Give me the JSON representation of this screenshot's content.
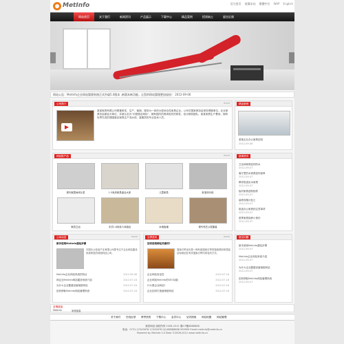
{
  "brand": {
    "logo_text": "MetInfo"
  },
  "toplinks": [
    "设为首页",
    "收藏本站",
    "繁體中文",
    "WAP",
    "English"
  ],
  "nav": [
    "网站首页",
    "关于我们",
    "新闻资讯",
    "产品展示",
    "下载中心",
    "精品案例",
    "招贤纳士",
    "留言反馈"
  ],
  "breadcrumb": "网站公告：MetInfo企业网站管理系统正式升级5.0版本 ,新版本新功能，让您的网站管理更加轻松！ 2012-09-06",
  "about": {
    "title": "公司简介",
    "more": "more",
    "body": "某某家具有限公司是集研发、生产、营销、服务为一体的大型综合性家具企业。公司中国家具协会常务理事单位，北京家具协会副会长单位，并被认定为\"中国驰名商标\"，拥有国内的具体相关的研发、设计精英团队。某某家具生产基地，拥有世界先进的德国豪迈家具生产流水线，高素质的专业技术人员。"
  },
  "cases": {
    "title": "精品案例",
    "more": "more",
    "caption": "某某企业办公家具定制",
    "date": "2012-09-08"
  },
  "products": {
    "title": "网站推产品",
    "more": "more",
    "items": [
      "现代家居休闲沙发",
      "1.5米床家具组合大床",
      "儿童家具",
      "卧室床头柜",
      "家具卫浴",
      "中式1.8米双人床组合",
      "木地板铺",
      "现代布艺沙发套装"
    ]
  },
  "news": {
    "title": "新闻资讯",
    "more": "more",
    "items": [
      {
        "t": "卫浴间家具如何防水",
        "d": "2012-09-07"
      },
      {
        "t": "客厅里的木家具如何保养",
        "d": "2012-09-07"
      },
      {
        "t": "教你挑选实木家具",
        "d": "2012-09-07"
      },
      {
        "t": "板材家具选购指导",
        "d": "2012-09-07"
      },
      {
        "t": "装修攻略小贴士",
        "d": "2012-09-07"
      },
      {
        "t": "挑选办公家具的注意事项",
        "d": "2012-09-07"
      },
      {
        "t": "夏季家具保养小常识",
        "d": "2012-09-07"
      }
    ]
  },
  "company": {
    "title": "公司动态",
    "more": "more",
    "headline": "新手使用MetInfo建站步骤",
    "body": "中国长沙信息产业有限公司是专注于企业网站建设系统研发的网络科技公司。",
    "items": [
      {
        "t": "MetInfo企业网站系统的特点",
        "d": "2012-09-06"
      },
      {
        "t": "网企业MetInfo网站建设系统介绍",
        "d": "2012-07-16"
      },
      {
        "t": "为什么企业要建设营销型网站",
        "d": "2012-07-16"
      },
      {
        "t": "如何获取MetInfo网站管理系统",
        "d": "2012-07-16"
      }
    ]
  },
  "industry": {
    "title": "业界资讯",
    "more": "more",
    "headline": "如何使用网站关键词?",
    "body": "搜索引擎优化是一种利用搜索引擎的搜索规则来提高目标网站在有关搜索引擎内排名的方式。",
    "items": [
      {
        "t": "企业网站安全性",
        "d": "2012-07-16"
      },
      {
        "t": "企业网站MetInfo的SEO功能",
        "d": "2012-07-16"
      },
      {
        "t": "什么是企业网站?",
        "d": "2012-07-16"
      },
      {
        "t": "企业如何打造营销型网站",
        "d": "2012-07-16"
      }
    ]
  },
  "faq": {
    "title": "常见问题",
    "more": "more",
    "items": [
      {
        "t": "新手使用MetInfo建站步骤",
        "d": "2012-09-07"
      },
      {
        "t": "MetInfo企业网站系统介绍",
        "d": "2012-09-07"
      },
      {
        "t": "为什么企业要建设营销型网站",
        "d": "2012-09-07"
      },
      {
        "t": "如何获取MetInfo网站管理系统",
        "d": "2012-09-07"
      }
    ]
  },
  "footnav": [
    "关于我们",
    "在线反馈",
    "荣誉资质",
    "下载中心",
    "会员中心",
    "站内搜索",
    "网站地图",
    "网站管理"
  ],
  "friend_links": {
    "title": "友情链接",
    "items": [
      "MetInfo",
      "米拓信息"
    ]
  },
  "footer": {
    "line1": "我的网站 版权所有 2008-2012 湘ICP备8888888",
    "line2": "电话：0731-12345678 12345678 QQ:88888888 999999 Email:metinfo@metinfo.cn",
    "line3": "Powered by MetInfo 5.0 Beta ©2008-2012 www.metinfo.cn"
  },
  "colors": {
    "accent": "#d22222",
    "nav": "#1f1f1f"
  }
}
